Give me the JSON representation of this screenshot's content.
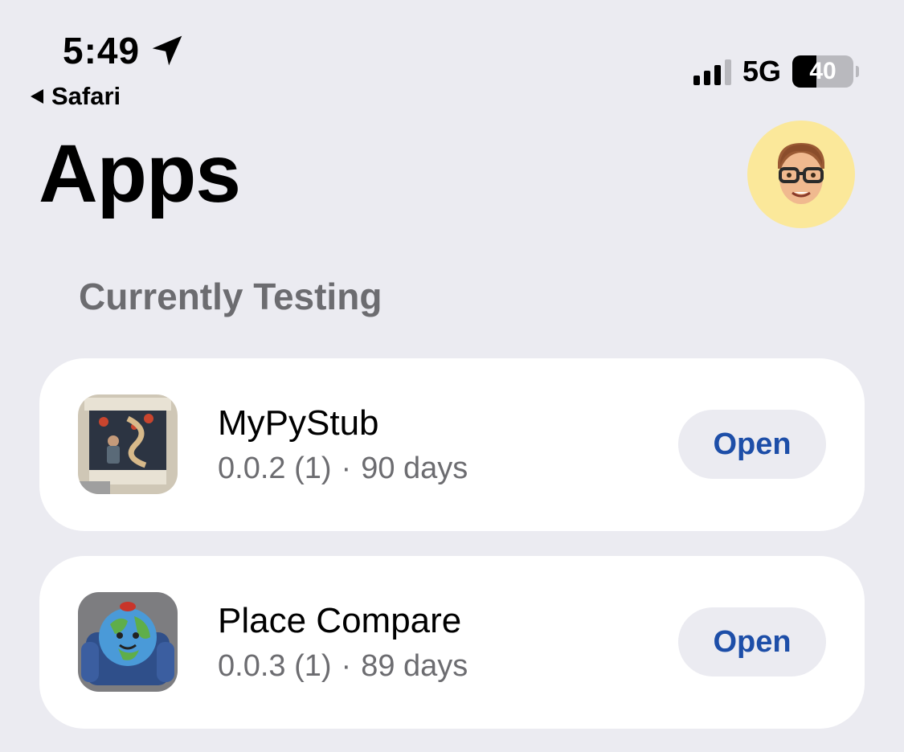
{
  "status_bar": {
    "time": "5:49",
    "back_label": "Safari",
    "network": "5G",
    "battery_percent": "40",
    "battery_level": 0.4,
    "signal_bars_active": 3,
    "signal_bars_total": 4
  },
  "header": {
    "title": "Apps"
  },
  "section": {
    "title": "Currently Testing"
  },
  "apps": [
    {
      "name": "MyPyStub",
      "version": "0.0.2 (1)",
      "separator": "·",
      "days": "90 days",
      "button_label": "Open",
      "icon": "ticket-poster-icon"
    },
    {
      "name": "Place Compare",
      "version": "0.0.3 (1)",
      "separator": "·",
      "days": "89 days",
      "button_label": "Open",
      "icon": "globe-armchair-icon"
    }
  ],
  "colors": {
    "background": "#ebebf1",
    "card": "#ffffff",
    "accent": "#1d4ea8",
    "secondary_text": "#6c6c70",
    "avatar_bg": "#fbe89a"
  }
}
